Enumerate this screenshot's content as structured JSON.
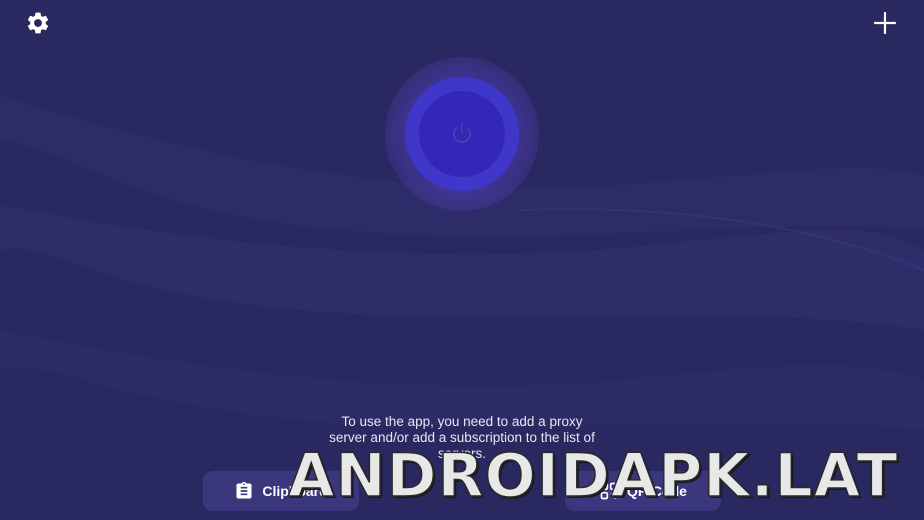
{
  "header": {
    "settings_icon": "gear-icon",
    "add_icon": "plus-icon"
  },
  "connect": {
    "icon": "power-icon"
  },
  "hint": {
    "line1": "To use the app, you need to add a proxy",
    "line2": "server and/or add a subscription to the list of",
    "line3": "servers."
  },
  "actions": {
    "clipboard_label": "Clipboard",
    "clipboard_icon": "clipboard-icon",
    "qr_label": "QR Code",
    "qr_icon": "qr-code-icon"
  },
  "watermark": {
    "text": "ANDROIDAPK.LAT"
  },
  "colors": {
    "background": "#292860",
    "button_primary": "#3326b8",
    "button_ring": "#3f37c9",
    "action_button": "#3e3a84"
  }
}
